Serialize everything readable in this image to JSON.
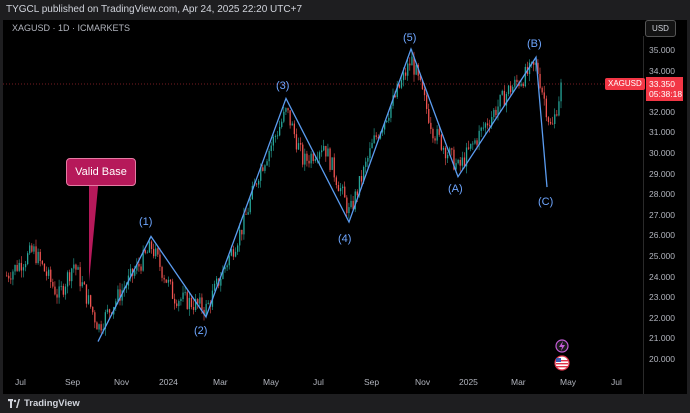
{
  "header": {
    "publish_text": "TYGCL published on TradingView.com, Apr 24, 2025 22:20 UTC+7"
  },
  "chart": {
    "symbol_line": "XAGUSD · 1D · ICMARKETS",
    "currency_button": "USD",
    "symbol_tag": "XAGUSD",
    "last_price": "33.350",
    "countdown": "05:38:18",
    "price_ticks": [
      "35.000",
      "34.000",
      "33.000",
      "32.000",
      "31.000",
      "30.000",
      "29.000",
      "28.000",
      "27.000",
      "26.000",
      "25.000",
      "24.000",
      "23.000",
      "22.000",
      "21.000",
      "20.000"
    ],
    "time_ticks": [
      "Jul",
      "Sep",
      "Nov",
      "2024",
      "Mar",
      "May",
      "Jul",
      "Sep",
      "Nov",
      "2025",
      "Mar",
      "May",
      "Jul"
    ],
    "callout_text": "Valid Base",
    "wave_labels": [
      "(1)",
      "(2)",
      "(3)",
      "(4)",
      "(5)",
      "(A)",
      "(B)",
      "(C)"
    ],
    "colors": {
      "up": "#26a69a",
      "down": "#ef5350",
      "wave": "#5b9cf0",
      "callout": "#b6195a",
      "price_tag": "#f23645"
    }
  },
  "footer": {
    "brand": "TradingView"
  }
}
